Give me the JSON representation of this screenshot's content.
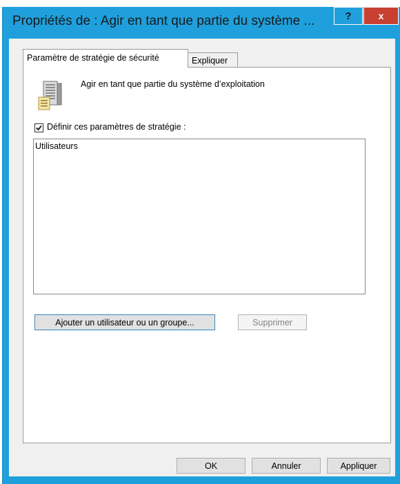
{
  "window": {
    "title": "Propriétés de : Agir en tant que partie du système ...",
    "help_label": "?",
    "close_label": "x"
  },
  "tabs": [
    {
      "label": "Paramètre de stratégie de sécurité",
      "active": true
    },
    {
      "label": "Expliquer",
      "active": false
    }
  ],
  "policy": {
    "name": "Agir en tant que partie du système d’exploitation",
    "icon": "server-policy-icon"
  },
  "define_checkbox": {
    "label": "Définir ces paramètres de stratégie :",
    "checked": true
  },
  "user_list": {
    "items": [
      "Utilisateurs"
    ]
  },
  "buttons": {
    "add_label": "Ajouter un utilisateur ou un groupe...",
    "remove_label": "Supprimer",
    "ok_label": "OK",
    "cancel_label": "Annuler",
    "apply_label": "Appliquer"
  },
  "colors": {
    "title_bar": "#1fa0dc",
    "close_button": "#c84031",
    "client_bg": "#f0f0f0"
  }
}
